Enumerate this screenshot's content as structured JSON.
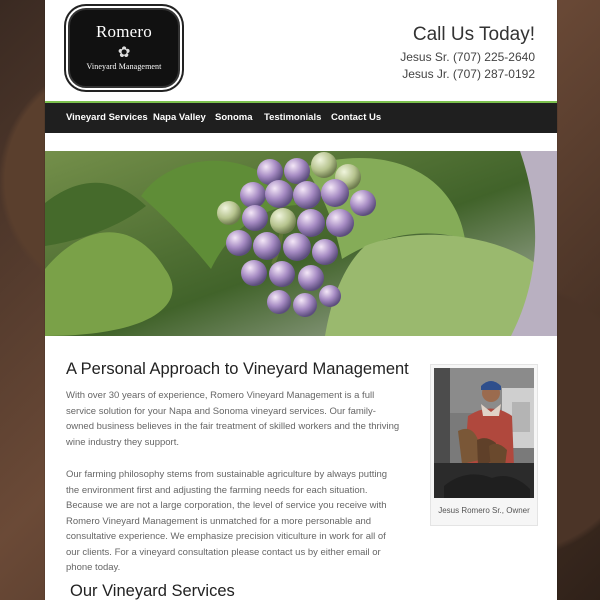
{
  "header": {
    "logo": {
      "title": "Romero",
      "subtitle": "Vineyard Management",
      "mark_icon": "grape-icon"
    },
    "call_title": "Call Us Today!",
    "phones": [
      "Jesus Sr. (707) 225-2640",
      "Jesus Jr. (707) 287-0192"
    ]
  },
  "nav": {
    "items": [
      {
        "label": "Vineyard Services"
      },
      {
        "label": "Napa Valley"
      },
      {
        "label": "Sonoma"
      },
      {
        "label": "Testimonials"
      },
      {
        "label": "Contact Us"
      }
    ]
  },
  "hero": {
    "icon": "grape-cluster-photo"
  },
  "main": {
    "title": "A Personal Approach to Vineyard Management",
    "paragraphs": [
      "With over 30 years of experience, Romero Vineyard Management is a full service solution for your Napa and Sonoma vineyard services. Our family-owned business believes in the fair treatment of skilled workers and the thriving wine industry they support.",
      "Our farming philosophy stems from sustainable agriculture by always putting the environment first and adjusting the farming needs for each situation. Because we are not a large corporation, the level of service you receive with Romero Vineyard Management is unmatched for a more personable and consultative experience. We emphasize precision viticulture in work for all of our clients. For a vineyard consultation please contact us by either email or phone today."
    ],
    "section2_title": "Our Vineyard Services"
  },
  "sidebar": {
    "caption": "Jesus Romero Sr., Owner"
  },
  "colors": {
    "accent": "#7cc04e",
    "nav_bg": "#1f1f1f"
  }
}
